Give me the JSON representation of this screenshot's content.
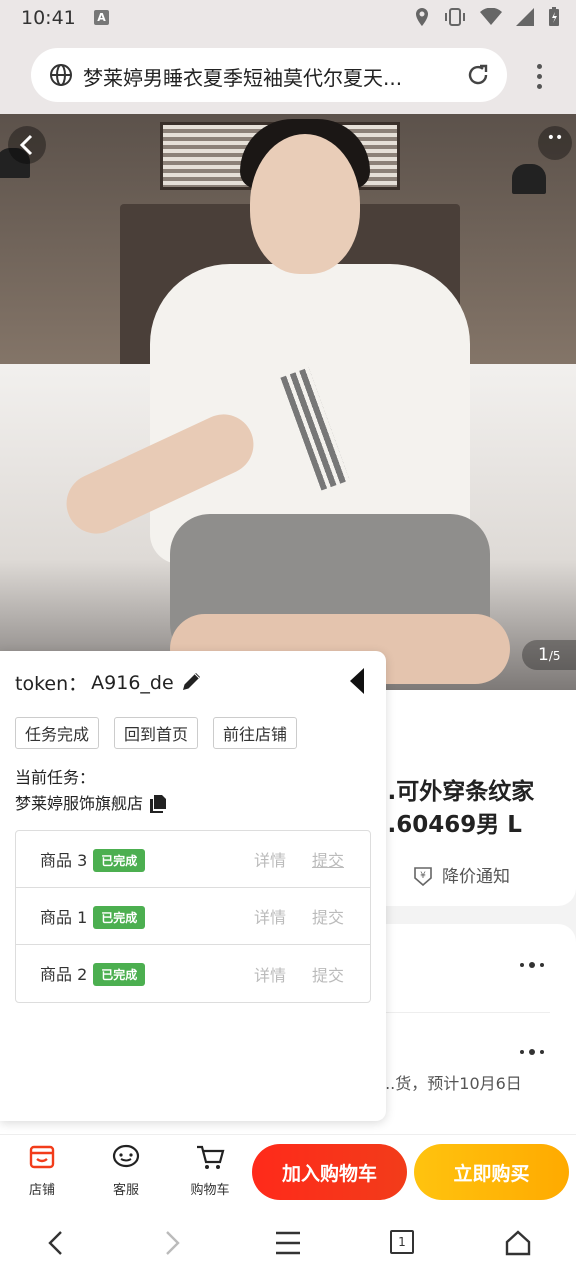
{
  "status_bar": {
    "time": "10:41",
    "notif_letter": "A"
  },
  "browser": {
    "page_title": "梦莱婷男睡衣夏季短袖莫代尔夏天..."
  },
  "gallery": {
    "current": "1",
    "total": "/5"
  },
  "product": {
    "title_line1": "...可外穿条纹家",
    "title_line2": "...60469男 L",
    "price_alert": "降价通知",
    "shipping": "...货，预计10月6日"
  },
  "panel": {
    "token_label": "token：",
    "token_value": "A916_de",
    "buttons": {
      "task_done": "任务完成",
      "go_home": "回到首页",
      "go_store": "前往店铺"
    },
    "current_task_label": "当前任务：",
    "store_name": "梦莱婷服饰旗舰店",
    "items": [
      {
        "name": "商品 3",
        "status": "已完成",
        "detail": "详情",
        "submit": "提交"
      },
      {
        "name": "商品 1",
        "status": "已完成",
        "detail": "详情",
        "submit": "提交"
      },
      {
        "name": "商品 2",
        "status": "已完成",
        "detail": "详情",
        "submit": "提交"
      }
    ]
  },
  "bottom_bar": {
    "store": "店铺",
    "service": "客服",
    "cart": "购物车",
    "add_to_cart": "加入购物车",
    "buy_now": "立即购买"
  },
  "nav": {
    "tabs_count": "1"
  },
  "colors": {
    "accent_red": "#f23c1a",
    "accent_yellow": "#ffb400",
    "badge_green": "#4caf50"
  }
}
